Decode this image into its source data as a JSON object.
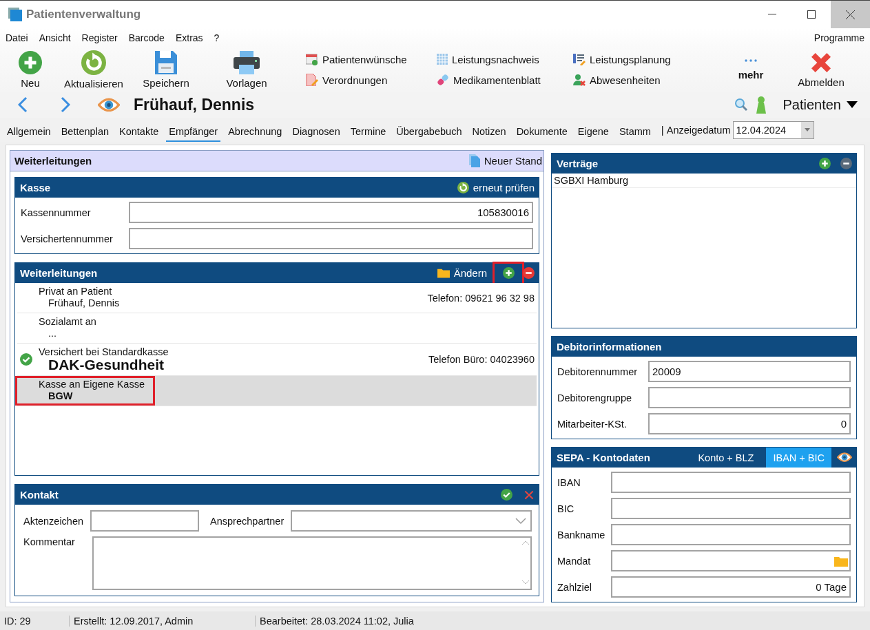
{
  "window": {
    "title": "Patientenverwaltung"
  },
  "menu": [
    "Datei",
    "Ansicht",
    "Register",
    "Barcode",
    "Extras",
    "?"
  ],
  "menu_right": "Programme",
  "toolbar": {
    "buttons": [
      {
        "label": "Neu",
        "kind": "add"
      },
      {
        "label": "Aktualisieren",
        "kind": "refresh"
      },
      {
        "label": "Speichern",
        "kind": "save"
      },
      {
        "label": "Vorlagen",
        "kind": "print"
      }
    ],
    "links": [
      {
        "label": "Patientenwünsche",
        "kind": "calendar"
      },
      {
        "label": "Verordnungen",
        "kind": "document"
      },
      {
        "label": "Leistungsnachweis",
        "kind": "grid"
      },
      {
        "label": "Medikamentenblatt",
        "kind": "pill"
      },
      {
        "label": "Leistungsplanung",
        "kind": "list"
      },
      {
        "label": "Abwesenheiten",
        "kind": "person"
      }
    ],
    "more": "mehr",
    "logout": "Abmelden"
  },
  "patient": {
    "name": "Frühauf, Dennis",
    "switcher": "Patienten"
  },
  "tabs": [
    {
      "label": "Allgemein",
      "selected": false
    },
    {
      "label": "Bettenplan",
      "selected": false
    },
    {
      "label": "Kontakte",
      "selected": false
    },
    {
      "label": "Empfänger",
      "selected": true
    },
    {
      "label": "Abrechnung",
      "selected": false
    },
    {
      "label": "Diagnosen",
      "selected": false
    },
    {
      "label": "Termine",
      "selected": false
    },
    {
      "label": "Übergabebuch",
      "selected": false
    },
    {
      "label": "Notizen",
      "selected": false
    },
    {
      "label": "Dokumente",
      "selected": false
    },
    {
      "label": "Eigene",
      "selected": false
    },
    {
      "label": "Stamm",
      "selected": false
    }
  ],
  "display_date": {
    "separator": "|",
    "label": "Anzeigedatum",
    "value": "12.04.2024"
  },
  "left": {
    "title": "Weiterleitungen",
    "action": "Neuer Stand",
    "kasse": {
      "title": "Kasse",
      "action": "erneut prüfen",
      "fields": [
        {
          "label": "Kassennummer",
          "value": "105830016",
          "kind": "number"
        },
        {
          "label": "Versichertennummer",
          "kind": "text"
        }
      ]
    },
    "forwarding": {
      "title": "Weiterleitungen",
      "action": "Ändern",
      "add_highlighted": true,
      "entries": [
        {
          "line1": "Privat an Patient",
          "line2": "Frühauf, Dennis",
          "kind": "plain",
          "phone": "Telefon: 09621 96 32 98",
          "verified": false,
          "selected": false,
          "highlighted": false
        },
        {
          "line1": "Sozialamt an",
          "line2": "...",
          "kind": "plain",
          "verified": false,
          "selected": false,
          "highlighted": false
        },
        {
          "line1": "Versichert bei Standardkasse",
          "line2": "DAK-Gesundheit",
          "kind": "large",
          "phone": "Telefon Büro: 04023960",
          "verified": true,
          "selected": false,
          "highlighted": false
        },
        {
          "line1": "Kasse an Eigene Kasse",
          "line2": "BGW",
          "kind": "bold",
          "verified": false,
          "selected": true,
          "highlighted": true
        }
      ]
    },
    "contact": {
      "title": "Kontakt",
      "fields": [
        {
          "label": "Aktenzeichen",
          "kind": "text"
        },
        {
          "label": "Ansprechpartner",
          "kind": "select"
        },
        {
          "label": "Kommentar",
          "kind": "textarea"
        }
      ]
    }
  },
  "right": {
    "contracts": {
      "title": "Verträge",
      "items": [
        "SGBXI Hamburg"
      ]
    },
    "debtor": {
      "title": "Debitorinformationen",
      "fields": [
        {
          "label": "Debitorennummer",
          "value": "20009",
          "kind": "text"
        },
        {
          "label": "Debitorengruppe",
          "kind": "text"
        },
        {
          "label": "Mitarbeiter-KSt.",
          "value": "0",
          "kind": "number"
        }
      ]
    },
    "sepa": {
      "title": "SEPA - Kontodaten",
      "modes": [
        {
          "label": "Konto + BLZ",
          "selected": false
        },
        {
          "label": "IBAN + BIC",
          "selected": true
        }
      ],
      "fields": [
        {
          "label": "IBAN",
          "kind": "text"
        },
        {
          "label": "BIC",
          "kind": "text"
        },
        {
          "label": "Bankname",
          "kind": "text"
        },
        {
          "label": "Mandat",
          "kind": "folder"
        },
        {
          "label": "Zahlziel",
          "value": "0 Tage",
          "kind": "number"
        }
      ]
    }
  },
  "status_bar": [
    "ID: 29",
    "Erstellt: 12.09.2017, Admin",
    "Bearbeitet: 28.03.2024 11:02, Julia"
  ]
}
